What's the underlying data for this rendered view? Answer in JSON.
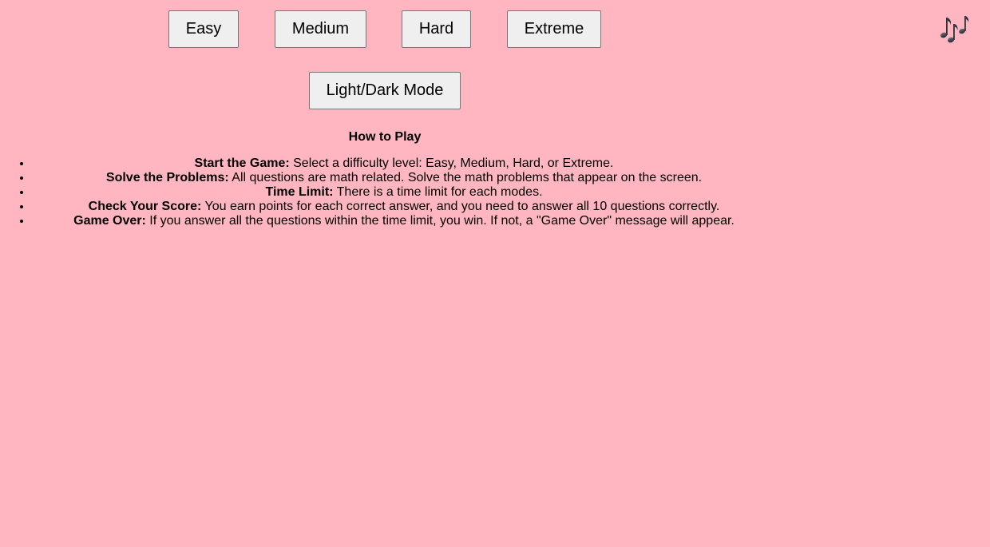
{
  "difficulty": {
    "easy_label": "Easy",
    "medium_label": "Medium",
    "hard_label": "Hard",
    "extreme_label": "Extreme"
  },
  "theme_toggle_label": "Light/Dark Mode",
  "music_icon": "music-notes-icon",
  "how_to_play": {
    "title": "How to Play",
    "items": [
      {
        "heading": "Start the Game:",
        "text": "Select a difficulty level: Easy, Medium, Hard, or Extreme."
      },
      {
        "heading": "Solve the Problems:",
        "text": "All questions are math related. Solve the math problems that appear on the screen."
      },
      {
        "heading": "Time Limit:",
        "text": "There is a time limit for each modes."
      },
      {
        "heading": "Check Your Score:",
        "text": "You earn points for each correct answer, and you need to answer all 10 questions correctly."
      },
      {
        "heading": "Game Over:",
        "text": "If you answer all the questions within the time limit, you win. If not, a \"Game Over\" message will appear."
      }
    ]
  },
  "colors": {
    "background": "#ffb6c1",
    "button_bg": "#efefef",
    "button_border": "#767676"
  }
}
